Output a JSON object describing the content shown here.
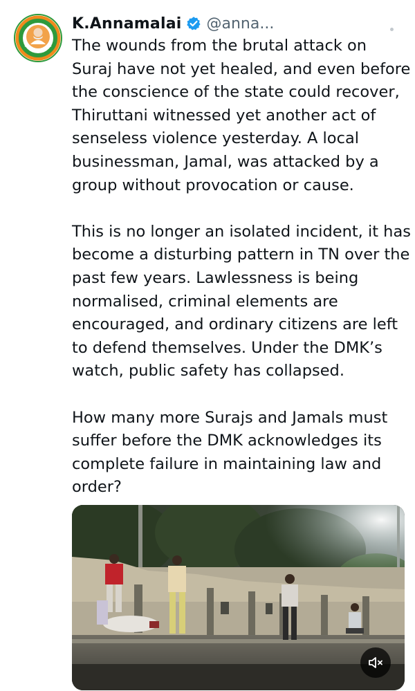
{
  "tweet": {
    "author": {
      "display_name": "K.Annamalai",
      "handle": "@anna...",
      "verified_icon": "verified-badge-icon",
      "avatar_icon": "profile-avatar"
    },
    "paragraphs": [
      "The wounds from the brutal attack on Suraj have not yet healed, and even before the conscience of the state could recover, Thiruttani witnessed yet another act of senseless violence yesterday. A local businessman, Jamal, was attacked by a group without provocation or cause.",
      "This is no longer an isolated incident, it has become a disturbing pattern in TN over the past few years. Lawlessness is being normalised, criminal elements are encouraged, and ordinary citizens are left to defend themselves. Under the DMK’s watch, public safety has collapsed.",
      "How many more Surajs and Jamals must suffer before the DMK acknowledges its complete failure in maintaining law and order?"
    ],
    "media": {
      "type": "video",
      "mute_icon": "muted-speaker-icon"
    },
    "colors": {
      "verified": "#1d9bf0",
      "text": "#0f1419",
      "secondary": "#536471"
    }
  }
}
